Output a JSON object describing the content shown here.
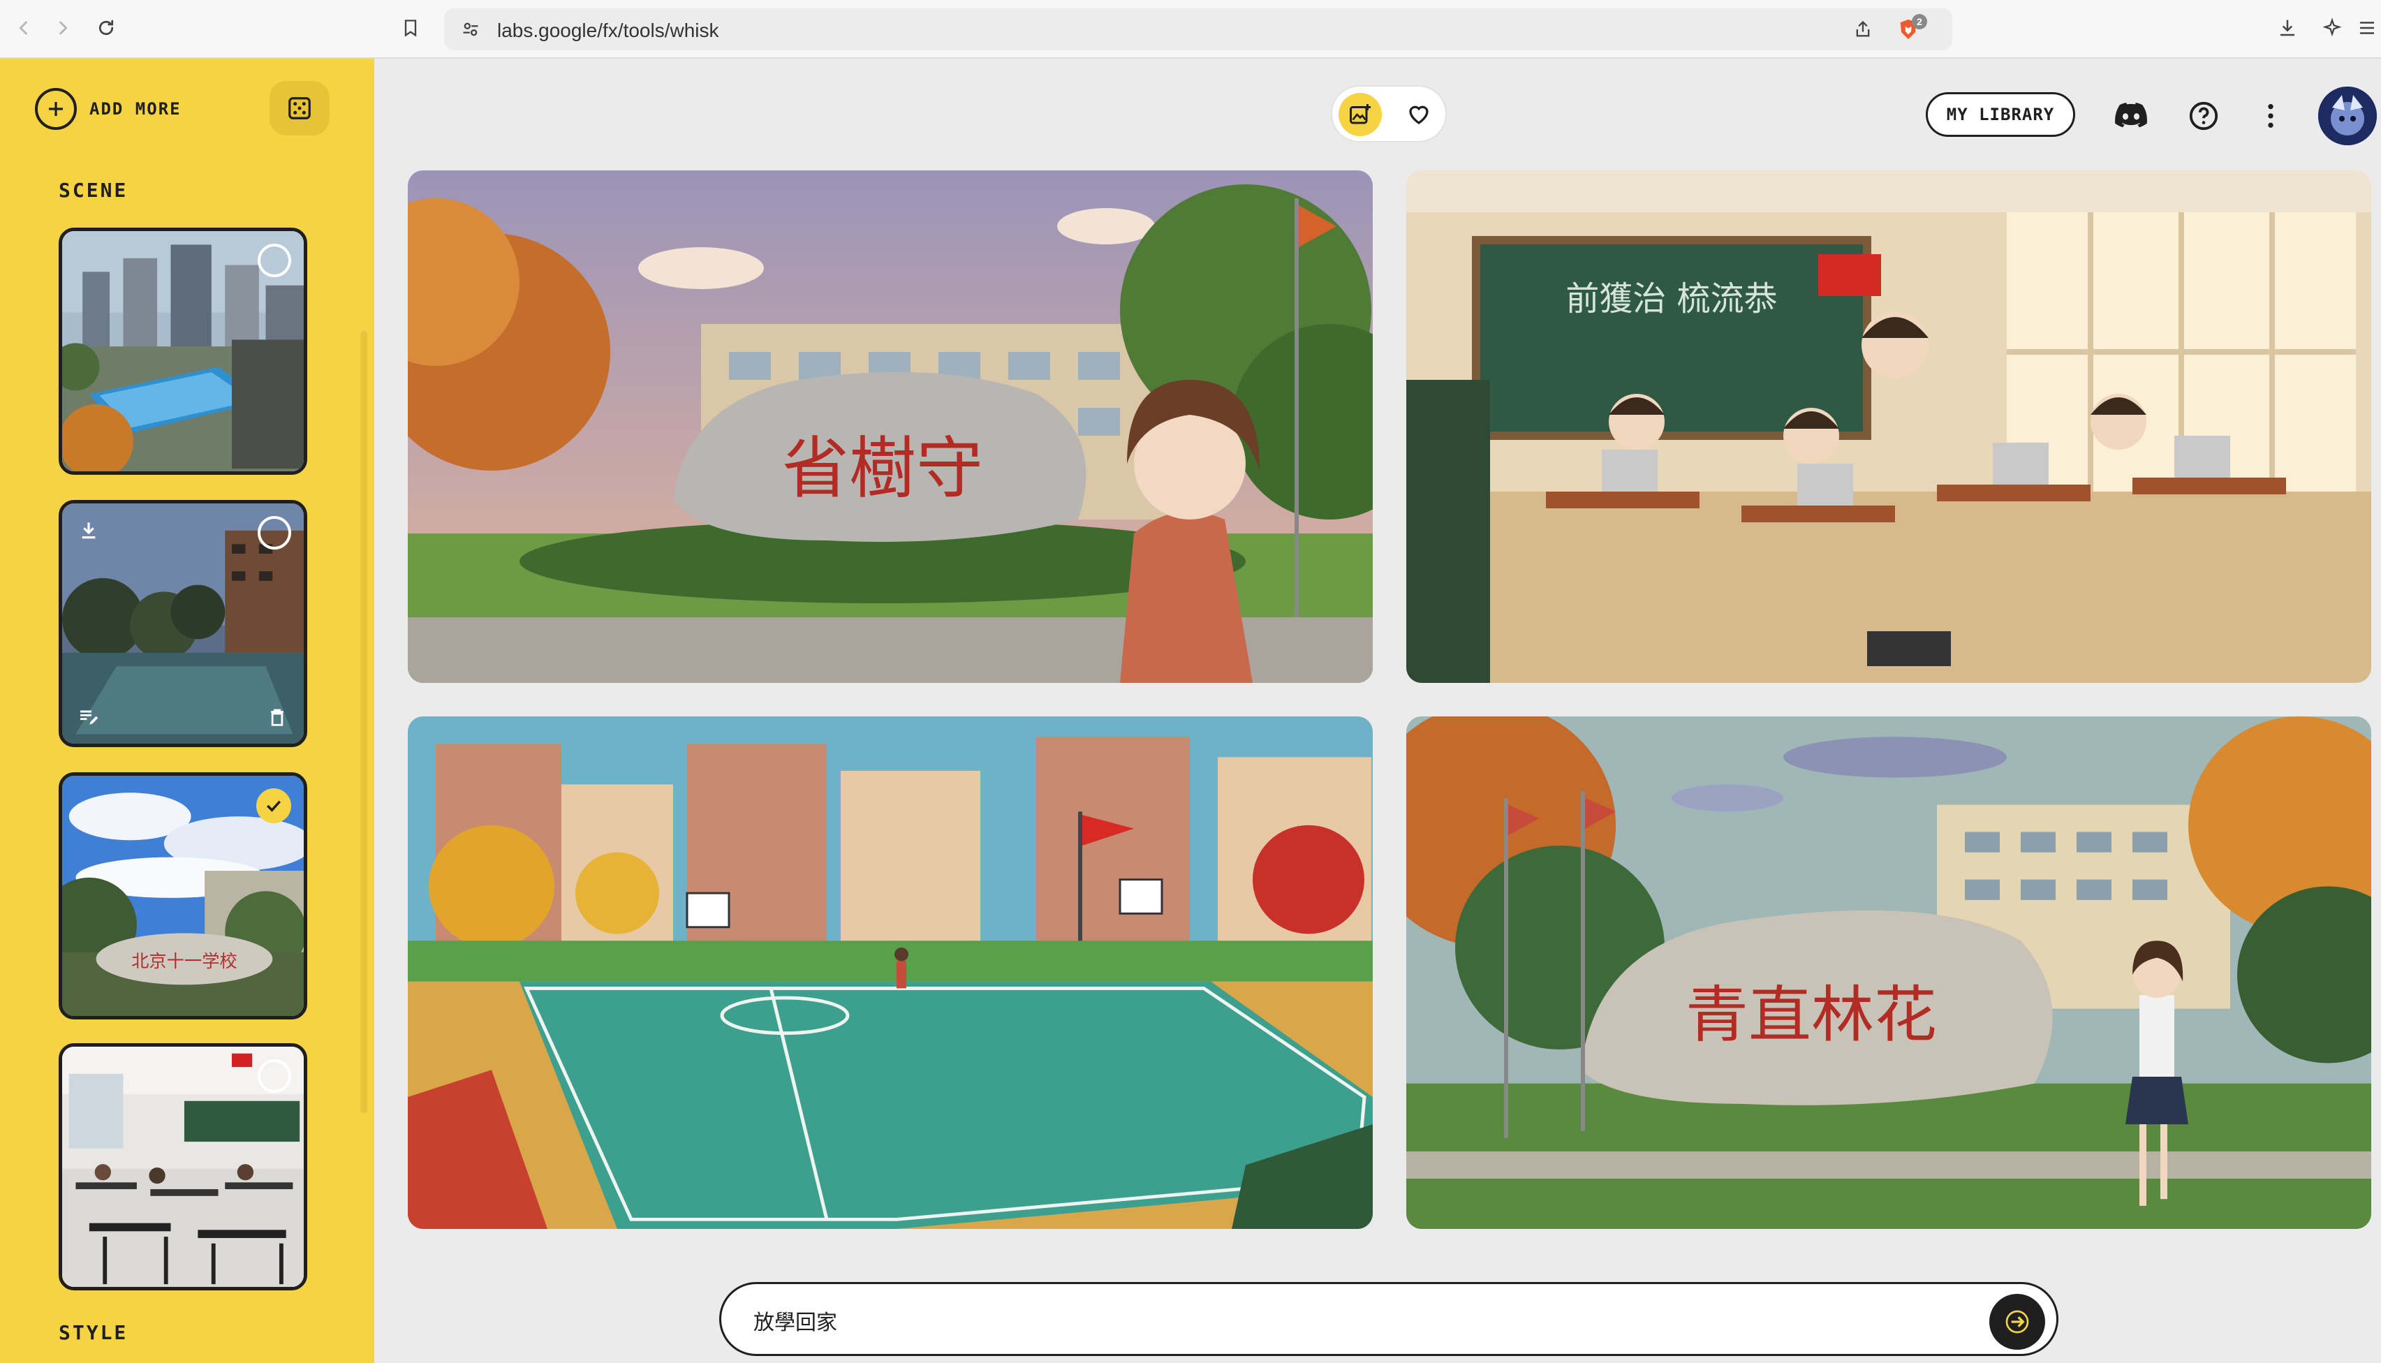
{
  "browser": {
    "url": "labs.google/fx/tools/whisk",
    "shield_badge": "2"
  },
  "sidebar": {
    "add_more_label": "ADD MORE",
    "scene_title": "SCENE",
    "style_title": "STYLE",
    "scenes": [
      {
        "selected": false
      },
      {
        "selected": false
      },
      {
        "selected": true
      },
      {
        "selected": false
      }
    ],
    "accent_color": "#f5d342"
  },
  "header": {
    "library_label": "MY LIBRARY"
  },
  "gallery": {
    "count": 4
  },
  "prompt": {
    "value": "放學回家",
    "placeholder": ""
  },
  "icons": {
    "back": "chevron-left-icon",
    "forward": "chevron-right-icon",
    "reload": "reload-icon",
    "bookmark": "bookmark-icon",
    "site_settings": "tune-icon",
    "share": "share-icon",
    "shield": "brave-shield-icon",
    "download": "download-icon",
    "leo": "sparkle-icon",
    "menu": "hamburger-icon",
    "add": "plus-circle-icon",
    "dice": "dice-icon",
    "discord": "discord-icon",
    "help": "help-icon",
    "more": "more-vert-icon",
    "send": "arrow-right-icon"
  }
}
